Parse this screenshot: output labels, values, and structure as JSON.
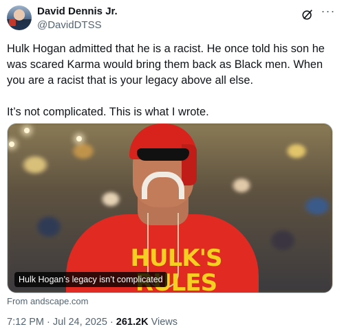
{
  "author": {
    "display_name": "David Dennis Jr.",
    "handle": "@DavidDTSS"
  },
  "header_icons": {
    "grok": "grok-icon",
    "more": "more-icon",
    "more_glyph": "···"
  },
  "tweet": {
    "paragraph_1": "Hulk Hogan admitted that he is a racist. He once told his son he was scared Karma would bring them back as Black men. When you are a racist that is your legacy above all else.",
    "paragraph_2": "It’s not complicated. This is what I wrote."
  },
  "media": {
    "shirt_text_line1": "HULK'S",
    "shirt_text_line2": "RULES",
    "caption": "Hulk Hogan’s legacy isn’t complicated",
    "source": "From andscape.com"
  },
  "meta": {
    "time": "7:12 PM",
    "sep1": " · ",
    "date": "Jul 24, 2025",
    "sep2": " · ",
    "views_count": "261.2K",
    "views_label": " Views"
  },
  "colors": {
    "text_primary": "#0f1419",
    "text_secondary": "#536471",
    "shirt_red": "#e02a22",
    "shirt_yellow": "#f5d020"
  }
}
